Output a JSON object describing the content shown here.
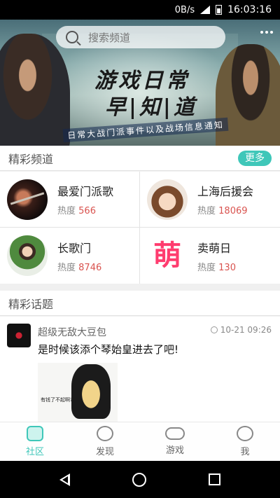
{
  "status_bar": {
    "speed": "0B/s",
    "network": "H",
    "time": "16:03:16"
  },
  "banner": {
    "title_line1": "游戏日常",
    "title_line2": "早|知|道",
    "subtitle": "日常大战门派事件以及战场信息通知",
    "search_placeholder": "搜索频道"
  },
  "channels_section": {
    "title": "精彩频道",
    "more_label": "更多",
    "items": [
      {
        "name": "最爱门派歌",
        "heat_label": "热度",
        "heat": "566"
      },
      {
        "name": "上海后援会",
        "heat_label": "热度",
        "heat": "18069"
      },
      {
        "name": "长歌门",
        "heat_label": "热度",
        "heat": "8746"
      },
      {
        "name": "卖萌日",
        "heat_label": "热度",
        "heat": "130",
        "icon_text": "萌"
      }
    ]
  },
  "topics_section": {
    "title": "精彩话题",
    "post": {
      "user": "超级无敌大豆包",
      "time": "10-21 09:26",
      "content": "是时候该添个琴始皇进去了吧!",
      "image_caption": "有钱了不起啊?"
    }
  },
  "bottom_nav": {
    "items": [
      {
        "label": "社区",
        "active": true
      },
      {
        "label": "发现"
      },
      {
        "label": "游戏"
      },
      {
        "label": "我"
      }
    ]
  }
}
